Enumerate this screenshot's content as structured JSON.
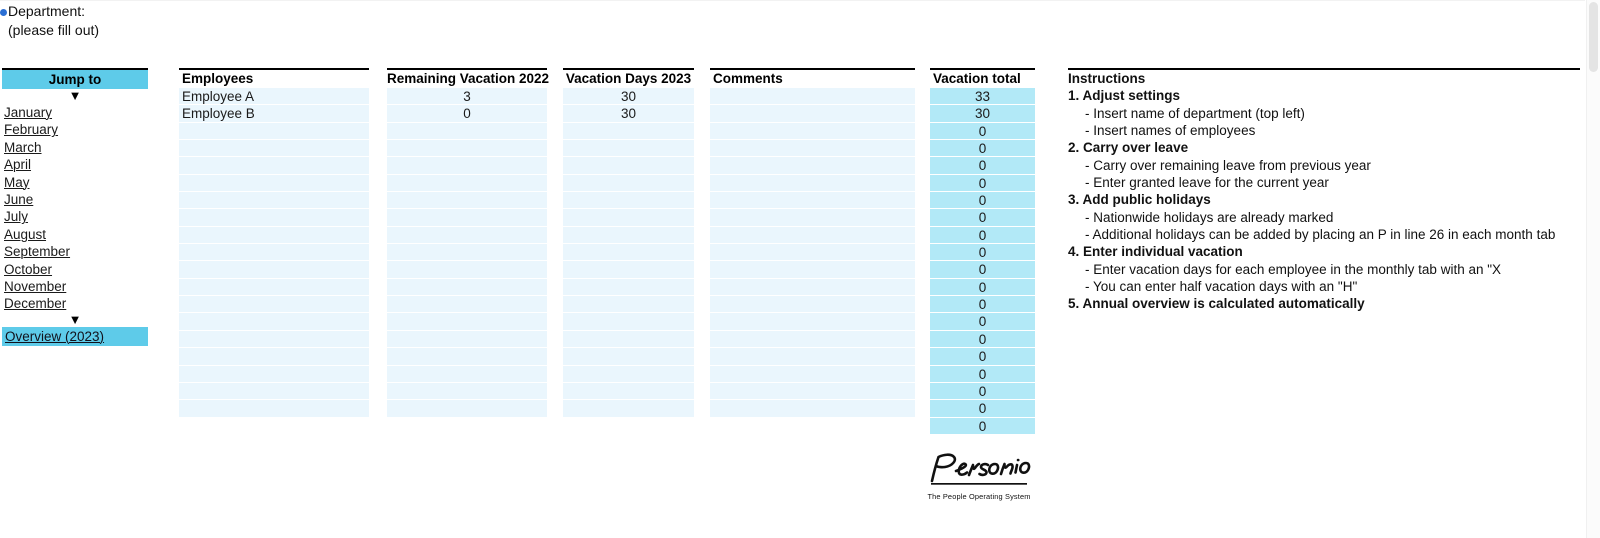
{
  "department": {
    "label": "Department:",
    "hint": "(please fill out)"
  },
  "sidebar": {
    "header": "Jump to",
    "caret": "▼",
    "months": [
      "January",
      "February",
      "March",
      "April",
      "May",
      "June",
      "July",
      "August",
      "September",
      "October",
      "November",
      "December"
    ],
    "overview": "Overview (2023)"
  },
  "table": {
    "headers": {
      "employees": "Employees",
      "remaining": "Remaining Vacation 2022",
      "days": "Vacation Days 2023",
      "comments": "Comments",
      "total": "Vacation total"
    },
    "rows": [
      {
        "employee": "Employee A",
        "remaining": "3",
        "days": "30",
        "comment": "",
        "total": "33"
      },
      {
        "employee": "Employee B",
        "remaining": "0",
        "days": "30",
        "comment": "",
        "total": "30"
      },
      {
        "employee": "",
        "remaining": "",
        "days": "",
        "comment": "",
        "total": "0"
      },
      {
        "employee": "",
        "remaining": "",
        "days": "",
        "comment": "",
        "total": "0"
      },
      {
        "employee": "",
        "remaining": "",
        "days": "",
        "comment": "",
        "total": "0"
      },
      {
        "employee": "",
        "remaining": "",
        "days": "",
        "comment": "",
        "total": "0"
      },
      {
        "employee": "",
        "remaining": "",
        "days": "",
        "comment": "",
        "total": "0"
      },
      {
        "employee": "",
        "remaining": "",
        "days": "",
        "comment": "",
        "total": "0"
      },
      {
        "employee": "",
        "remaining": "",
        "days": "",
        "comment": "",
        "total": "0"
      },
      {
        "employee": "",
        "remaining": "",
        "days": "",
        "comment": "",
        "total": "0"
      },
      {
        "employee": "",
        "remaining": "",
        "days": "",
        "comment": "",
        "total": "0"
      },
      {
        "employee": "",
        "remaining": "",
        "days": "",
        "comment": "",
        "total": "0"
      },
      {
        "employee": "",
        "remaining": "",
        "days": "",
        "comment": "",
        "total": "0"
      },
      {
        "employee": "",
        "remaining": "",
        "days": "",
        "comment": "",
        "total": "0"
      },
      {
        "employee": "",
        "remaining": "",
        "days": "",
        "comment": "",
        "total": "0"
      },
      {
        "employee": "",
        "remaining": "",
        "days": "",
        "comment": "",
        "total": "0"
      },
      {
        "employee": "",
        "remaining": "",
        "days": "",
        "comment": "",
        "total": "0"
      },
      {
        "employee": "",
        "remaining": "",
        "days": "",
        "comment": "",
        "total": "0"
      },
      {
        "employee": "",
        "remaining": "",
        "days": "",
        "comment": "",
        "total": "0"
      },
      {
        "employee": "",
        "remaining": "",
        "days": "",
        "comment": "",
        "total": "0"
      }
    ]
  },
  "instructions": {
    "title": "Instructions",
    "lines": [
      {
        "text": "1. Adjust settings",
        "bold": true
      },
      {
        "text": "- Insert name of department (top left)",
        "bold": false
      },
      {
        "text": "- Insert names of employees",
        "bold": false
      },
      {
        "text": "2. Carry over leave",
        "bold": true
      },
      {
        "text": "- Carry over remaining leave from previous year",
        "bold": false
      },
      {
        "text": "- Enter granted leave for the current year",
        "bold": false
      },
      {
        "text": "3. Add public holidays",
        "bold": true
      },
      {
        "text": "- Nationwide holidays are already marked",
        "bold": false
      },
      {
        "text": "- Additional holidays can be added by placing an P in line 26 in each month tab",
        "bold": false
      },
      {
        "text": "4. Enter individual vacation",
        "bold": true
      },
      {
        "text": "- Enter vacation days for each employee in the monthly tab with an \"X",
        "bold": false
      },
      {
        "text": "- You can enter half vacation days with an \"H\"",
        "bold": false
      },
      {
        "text": "5. Annual overview is calculated automatically",
        "bold": true
      }
    ]
  },
  "logo": {
    "wordmark": "Personio",
    "tagline": "The People Operating System"
  },
  "colors": {
    "accent_blue": "#5ecbe9",
    "cell_light": "#eaf6fd",
    "cell_total": "#b2e9f7",
    "rule": "#000000",
    "marker": "#2b6fd4"
  }
}
